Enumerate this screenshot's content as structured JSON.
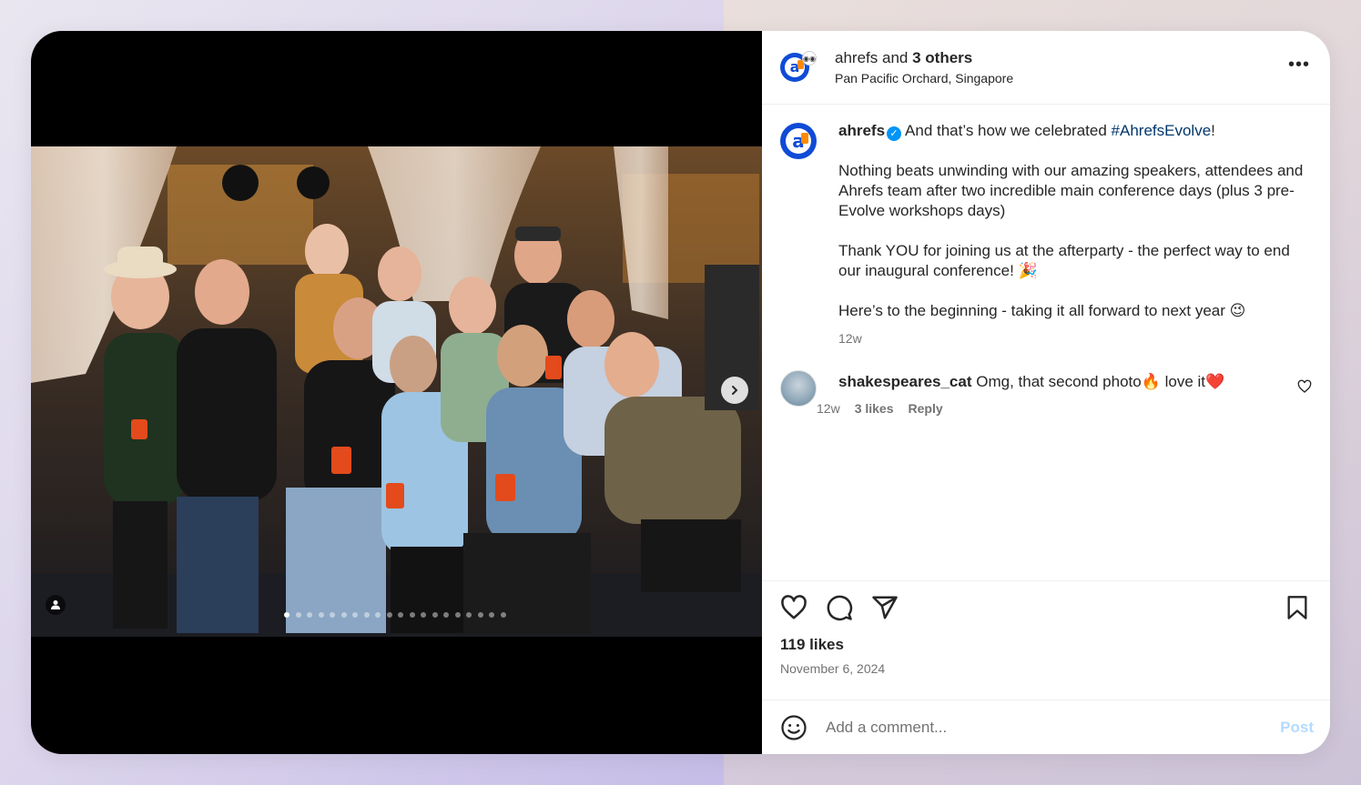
{
  "header": {
    "account": "ahrefs",
    "connector": "and",
    "others": "3 others",
    "location": "Pan Pacific Orchard, Singapore",
    "more_icon": "more-horizontal-icon"
  },
  "caption": {
    "username": "ahrefs",
    "line1": "And that’s how we celebrated ",
    "hashtag": "#AhrefsEvolve",
    "line1_end": "!",
    "para2": "Nothing beats unwinding with our amazing speakers, attendees and Ahrefs team after two incredible main conference days (plus 3 pre-Evolve workshops days)",
    "para3": "Thank YOU for joining us at the afterparty - the perfect way to end our inaugural conference! 🎉",
    "para4": "Here’s to the beginning - taking it all forward to next year 😉",
    "time": "12w"
  },
  "comments": [
    {
      "username": "shakespeares_cat",
      "text": "Omg, that second photo🔥 love it❤️",
      "time": "12w",
      "likes": "3 likes",
      "reply": "Reply"
    }
  ],
  "actions": {
    "likes": "119 likes",
    "date": "November 6, 2024"
  },
  "add_comment": {
    "placeholder": "Add a comment...",
    "post_label": "Post"
  },
  "carousel": {
    "total": 20,
    "active": 1
  },
  "colors": {
    "brand": "#0f4bd6",
    "accent": "#ff8a00",
    "link": "#00376b",
    "verified": "#0095f6"
  }
}
